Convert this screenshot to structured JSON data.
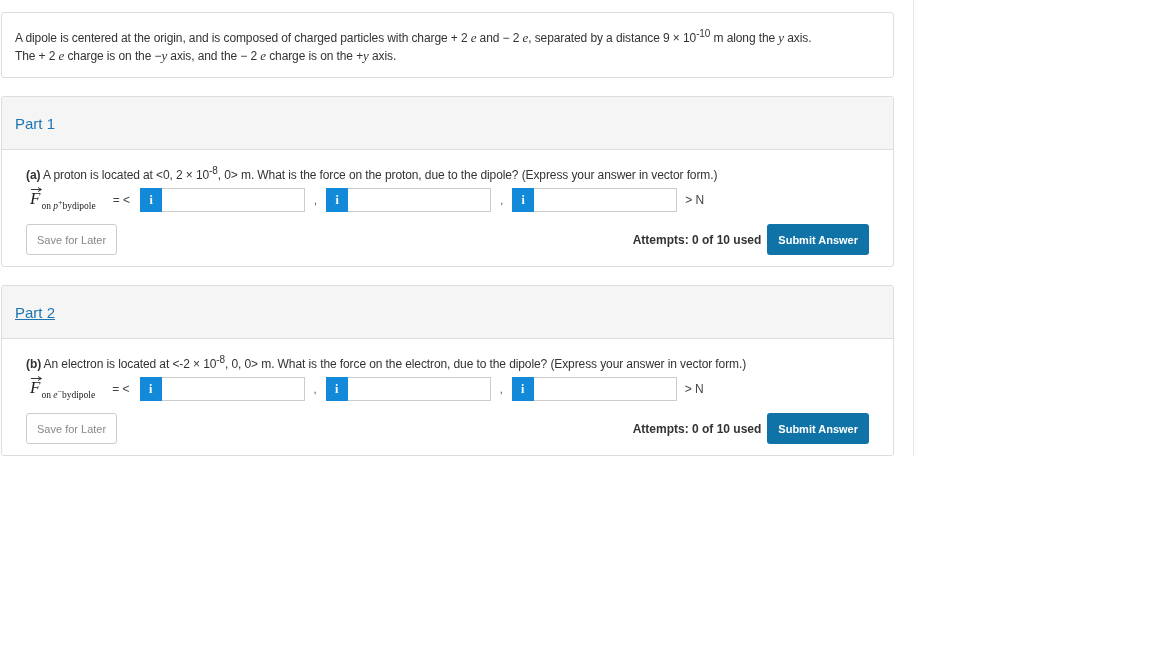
{
  "problem": {
    "statement": [
      "A dipole is centered at the origin, and is composed of charged particles with charge + 2 *e* and − 2 *e*, separated by a distance 9 × 10$^{-10}$ m along the *y* axis.",
      "The + 2 *e* charge is on the −*y* axis, and the − 2 *e* charge is on the +*y* axis."
    ]
  },
  "parts": [
    {
      "title": "Part 1",
      "hovered": false,
      "question": "**(a)** A proton is located at <0, 2 × 10$^{-8}$, 0> m. What is the force on the proton, due to the dipole? (Express your answer in vector form.)",
      "answer": {
        "symbol": "F",
        "subscript": "on *p*$^{+}$bydipole",
        "open": "= <",
        "fields": [
          {
            "info": "i"
          },
          {
            "separator": ",",
            "info": "i"
          },
          {
            "separator": ",",
            "info": "i"
          }
        ],
        "close": "> N"
      },
      "save_button": "Save for Later",
      "attempts": "Attempts: 0 of 10 used",
      "submit_button": "Submit Answer"
    },
    {
      "title": "Part 2",
      "hovered": true,
      "question": "**(b)** An electron is located at <-2 × 10$^{-8}$, 0, 0> m. What is the force on the electron, due to the dipole? (Express your answer in vector form.)",
      "answer": {
        "symbol": "F",
        "subscript": "on *e*$^{−}$bydipole",
        "open": "= <",
        "fields": [
          {
            "info": "i"
          },
          {
            "separator": ",",
            "info": "i"
          },
          {
            "separator": ",",
            "info": "i"
          }
        ],
        "close": "> N"
      },
      "save_button": "Save for Later",
      "attempts": "Attempts: 0 of 10 used",
      "submit_button": "Submit Answer"
    }
  ]
}
